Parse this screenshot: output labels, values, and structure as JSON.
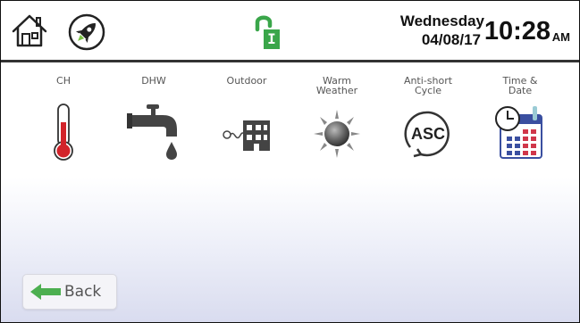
{
  "header": {
    "day_of_week": "Wednesday",
    "date": "04/08/17",
    "time": "10:28",
    "ampm": "AM",
    "lock_letter": "I"
  },
  "menu": {
    "items": [
      {
        "label": "CH",
        "icon": "thermometer-icon"
      },
      {
        "label": "DHW",
        "icon": "faucet-icon"
      },
      {
        "label": "Outdoor",
        "icon": "outdoor-sensor-icon"
      },
      {
        "label": "Warm\nWeather",
        "icon": "sun-icon"
      },
      {
        "label": "Anti-short\nCycle",
        "icon": "asc-icon"
      },
      {
        "label": "Time &\nDate",
        "icon": "calendar-clock-icon"
      }
    ],
    "asc_text": "ASC"
  },
  "footer": {
    "back_label": "Back"
  },
  "colors": {
    "lock_green": "#3aa64a",
    "back_arrow_green": "#4caf50",
    "thermometer_red": "#d2232a",
    "calendar_blue": "#3a4fa0",
    "calendar_red": "#d0364a"
  }
}
